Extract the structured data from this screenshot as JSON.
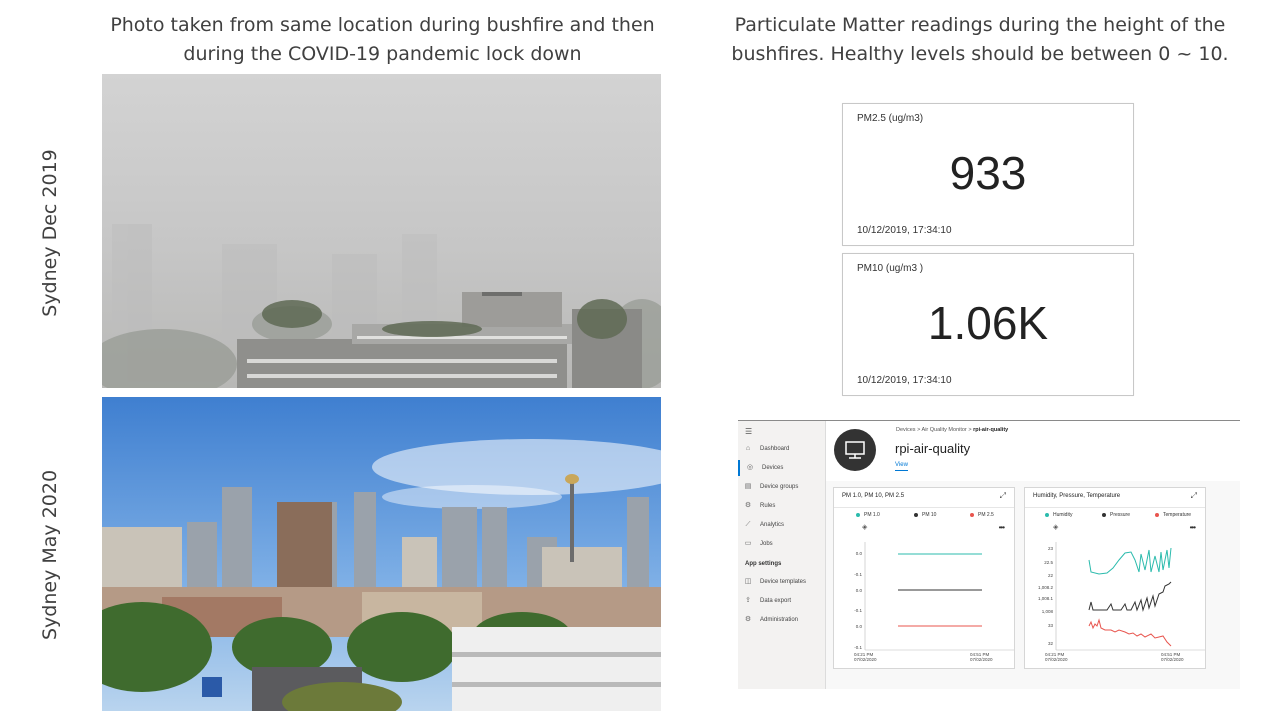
{
  "headings": {
    "left": "Photo taken from same location during bushfire and then during the COVID-19 pandemic lock down",
    "right": "Particulate Matter readings during the height of the bushfires. Healthy levels should be between 0 ~ 10."
  },
  "labels": {
    "top": "Sydney Dec 2019",
    "bottom": "Sydney May 2020"
  },
  "tiles": [
    {
      "label": "PM2.5 (ug/m3)",
      "value": "933",
      "timestamp": "10/12/2019, 17:34:10"
    },
    {
      "label": "PM10 (ug/m3 )",
      "value": "1.06K",
      "timestamp": "10/12/2019, 17:34:10"
    }
  ],
  "dashboard": {
    "menu_icon": "hamburger-icon",
    "nav": [
      {
        "label": "Dashboard",
        "icon": "dashboard-icon"
      },
      {
        "label": "Devices",
        "icon": "devices-icon",
        "active": true
      },
      {
        "label": "Device groups",
        "icon": "device-groups-icon"
      },
      {
        "label": "Rules",
        "icon": "rules-icon"
      },
      {
        "label": "Analytics",
        "icon": "analytics-icon"
      },
      {
        "label": "Jobs",
        "icon": "jobs-icon"
      }
    ],
    "app_settings_label": "App settings",
    "settings_nav": [
      {
        "label": "Device templates",
        "icon": "device-templates-icon"
      },
      {
        "label": "Data export",
        "icon": "data-export-icon"
      },
      {
        "label": "Administration",
        "icon": "administration-icon"
      }
    ],
    "breadcrumb": [
      "Devices",
      "Air Quality Monitor",
      "rpi-air-quality"
    ],
    "device_name": "rpi-air-quality",
    "view_tab": "View",
    "cards": [
      {
        "title": "PM 1.0, PM 10, PM 2.5",
        "legend": [
          {
            "name": "PM 1.0",
            "color": "#2bbbad"
          },
          {
            "name": "PM 10",
            "color": "#333333"
          },
          {
            "name": "PM 2.5",
            "color": "#e8554e"
          }
        ],
        "yticks": [
          "0.0",
          "-0.1",
          "0.0",
          "-0.1",
          "0.0",
          "-0.1"
        ],
        "xticks": [
          {
            "time": "04:21 PM",
            "date": "07/02/2020"
          },
          {
            "time": "04:51 PM",
            "date": "07/02/2020"
          }
        ]
      },
      {
        "title": "Humidity, Pressure, Temperature",
        "legend": [
          {
            "name": "Humidity",
            "color": "#2bbbad"
          },
          {
            "name": "Pressure",
            "color": "#333333"
          },
          {
            "name": "Temperature",
            "color": "#e8554e"
          }
        ],
        "yticks": [
          "23",
          "22.5",
          "22",
          "1,008.2",
          "1,008.1",
          "1,008",
          "33",
          "32"
        ],
        "xticks": [
          {
            "time": "04:21 PM",
            "date": "07/02/2020"
          },
          {
            "time": "04:51 PM",
            "date": "07/02/2020"
          }
        ]
      }
    ]
  }
}
